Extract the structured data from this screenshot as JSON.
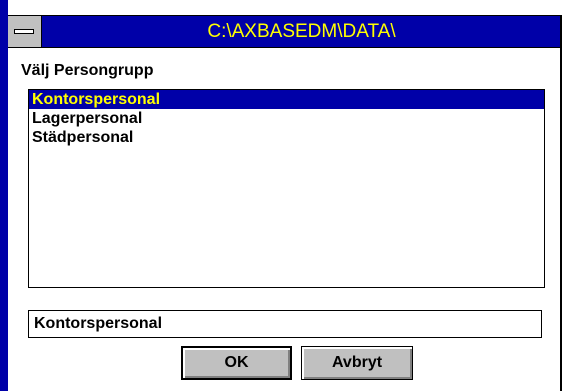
{
  "window": {
    "title": "C:\\AXBASEDM\\DATA\\"
  },
  "dialog": {
    "prompt": "Välj Persongrupp",
    "list_items": [
      {
        "label": "Kontorspersonal",
        "selected": true
      },
      {
        "label": "Lagerpersonal",
        "selected": false
      },
      {
        "label": "Städpersonal",
        "selected": false
      }
    ],
    "selection_value": "Kontorspersonal",
    "ok_label": "OK",
    "cancel_label": "Avbryt"
  },
  "colors": {
    "title_bg": "#0000a8",
    "title_text": "#ffff00",
    "selection_bg": "#0000a8",
    "selection_text": "#ffff00",
    "button_face": "#c0c0c0"
  },
  "icons": {
    "system_menu": "system-menu-icon"
  }
}
